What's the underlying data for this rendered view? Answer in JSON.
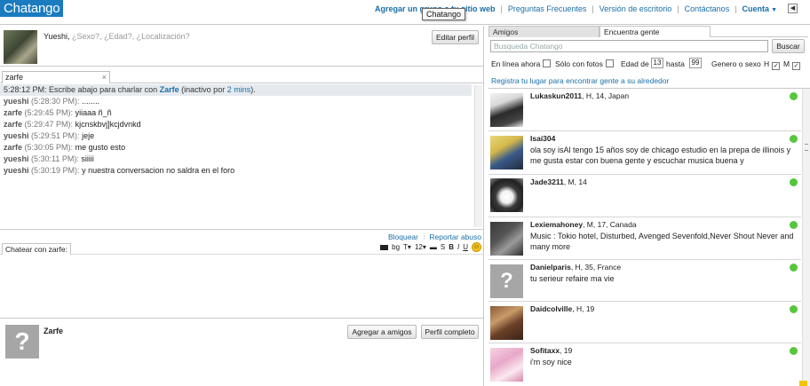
{
  "app": {
    "logo": "Chatango"
  },
  "topnav": {
    "add_web": "Agregar un grupo a tu sitio web",
    "faq": "Preguntas Frecuentes",
    "desktop": "Versión de escritorio",
    "contact": "Contáctanos",
    "account": "Cuenta"
  },
  "tooltip": "Chatango",
  "me": {
    "name": "Yueshi,",
    "placeholders": "¿Sexo?, ¿Edad?, ¿Localización?",
    "edit_button": "Editar perfil"
  },
  "chat": {
    "tab_label": "zarfe",
    "system": {
      "time": "5:28:12 PM:",
      "text": "Escribe abajo para charlar con",
      "name": "Zarfe",
      "inactive_pre": "(inactivo por",
      "inactive_time": "2 mins",
      "inactive_post": ")."
    },
    "messages": [
      {
        "name": "yueshi",
        "time": "(5:28:30 PM):",
        "text": "........"
      },
      {
        "name": "zarfe",
        "time": "(5:29:45 PM):",
        "text": "yiiaaa ñ_ñ"
      },
      {
        "name": "zarfe",
        "time": "(5:29:47 PM):",
        "text": "kjcnskbvj]kcjdvnkd"
      },
      {
        "name": "yueshi",
        "time": "(5:29:51 PM):",
        "text": "jeje"
      },
      {
        "name": "zarfe",
        "time": "(5:30:05 PM):",
        "text": "me gusto esto"
      },
      {
        "name": "yueshi",
        "time": "(5:30:11 PM):",
        "text": "siiiii"
      },
      {
        "name": "yueshi",
        "time": "(5:30:19 PM):",
        "text": "y nuestra conversacion no saldra en el foro"
      }
    ],
    "block": "Bloquear",
    "report": "Reportar abuso",
    "input_label": "Chatear con zarfe:",
    "font_size": "12",
    "tools": {
      "bg": "bg",
      "t": "T",
      "s": "S",
      "b": "B",
      "i": "I",
      "u": "U"
    }
  },
  "bottom_profile": {
    "name": "Zarfe",
    "add_friends": "Agregar a amigos",
    "full_profile": "Perfil completo",
    "placeholder_glyph": "?",
    "flag_glyph": "⚑"
  },
  "right": {
    "tabs": [
      "Amigos",
      "Encuentra gente"
    ],
    "search_placeholder": "Busqueda Chatango",
    "search_button": "Buscar",
    "filters": {
      "online_now": "En línea ahora",
      "photos_only": "Sólo con fotos",
      "age_from_label": "Edad de",
      "age_from": "13",
      "age_to_label": "hasta",
      "age_to": "99",
      "gender_label": "Genero o sexo",
      "h": "H",
      "m": "M",
      "check": "✓"
    },
    "region_link": "Registra tu lugar para encontrar gente a su alrededor",
    "users": [
      {
        "name": "Lukaskun2011",
        "meta": ", H, 14, Japan",
        "status": "",
        "avatar": "anime-dark"
      },
      {
        "name": "Isai304",
        "meta": "",
        "status": "ola soy isAl tengo 15 años soy de chicago estudio en la prepa de illinois y me gusta estar con buena gente y escuchar musica buena y",
        "avatar": "anime-yellow"
      },
      {
        "name": "Jade3211",
        "meta": ", M, 14",
        "status": "",
        "avatar": "husky"
      },
      {
        "name": "Lexiemahoney",
        "meta": ", M, 17, Canada",
        "status": "Music : Tokio hotel, Disturbed, Avenged Sevenfold,Never Shout Never and many more",
        "avatar": "photo-dark"
      },
      {
        "name": "Danielparis",
        "meta": ", H, 35, France",
        "status": "tu serieur refaire ma vie",
        "avatar": "placeholder"
      },
      {
        "name": "Daidcolville",
        "meta": ", H, 19",
        "status": "",
        "avatar": "photo-warm"
      },
      {
        "name": "Sofitaxx",
        "meta": ", 19",
        "status": "i'm soy  nice",
        "avatar": "anime-pink"
      }
    ]
  },
  "colors": {
    "brand": "#1a7bbf",
    "link": "#1a6ea8",
    "online": "#56c63c"
  }
}
